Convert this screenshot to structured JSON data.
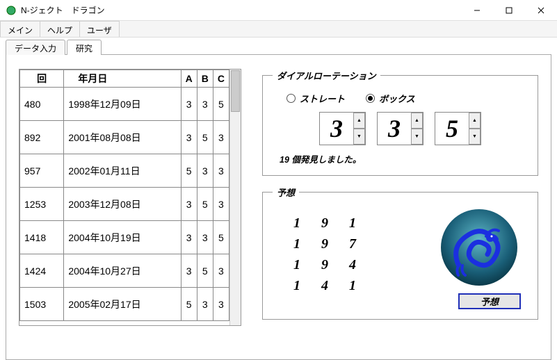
{
  "title": "N-ジェクト　ドラゴン",
  "menu": {
    "main": "メイン",
    "help": "ヘルプ",
    "user": "ユーザ"
  },
  "tabs": {
    "input": "データ入力",
    "research": "研究"
  },
  "active_tab": "research",
  "table": {
    "headers": {
      "round": "回",
      "ymd": "年月日",
      "a": "A",
      "b": "B",
      "c": "C"
    },
    "rows": [
      {
        "round": "480",
        "ymd": "1998年12月09日",
        "a": "3",
        "b": "3",
        "c": "5"
      },
      {
        "round": "892",
        "ymd": "2001年08月08日",
        "a": "3",
        "b": "5",
        "c": "3"
      },
      {
        "round": "957",
        "ymd": "2002年01月11日",
        "a": "5",
        "b": "3",
        "c": "3"
      },
      {
        "round": "1253",
        "ymd": "2003年12月08日",
        "a": "3",
        "b": "5",
        "c": "3"
      },
      {
        "round": "1418",
        "ymd": "2004年10月19日",
        "a": "3",
        "b": "3",
        "c": "5"
      },
      {
        "round": "1424",
        "ymd": "2004年10月27日",
        "a": "3",
        "b": "5",
        "c": "3"
      },
      {
        "round": "1503",
        "ymd": "2005年02月17日",
        "a": "5",
        "b": "3",
        "c": "3"
      }
    ]
  },
  "dial": {
    "legend": "ダイアルローテーション",
    "straight": "ストレート",
    "box": "ボックス",
    "selected": "box",
    "values": {
      "a": "3",
      "b": "3",
      "c": "5"
    },
    "status": "19 個発見しました。"
  },
  "predict": {
    "legend": "予想",
    "rows": [
      [
        "1",
        "9",
        "1"
      ],
      [
        "1",
        "9",
        "7"
      ],
      [
        "1",
        "9",
        "4"
      ],
      [
        "1",
        "4",
        "1"
      ]
    ],
    "button": "予想"
  }
}
